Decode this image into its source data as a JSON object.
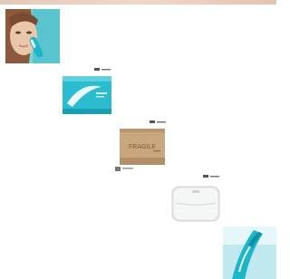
{
  "gallery": {
    "items": [
      {
        "name": "model-with-device",
        "icon": "woman-face-with-device"
      },
      {
        "name": "product-retail-box",
        "icon": "teal-retail-box"
      },
      {
        "name": "shipping-carton",
        "label": "FRAGILE",
        "icon": "cardboard-box"
      },
      {
        "name": "travel-case",
        "icon": "white-pouch"
      },
      {
        "name": "device-closeup",
        "icon": "teal-device"
      }
    ]
  },
  "colors": {
    "teal": "#1fb5c9",
    "teal_dark": "#0f8fa3",
    "cardboard": "#c9a77e",
    "skin": "#e9c2a6",
    "hair": "#8b5a3c"
  }
}
